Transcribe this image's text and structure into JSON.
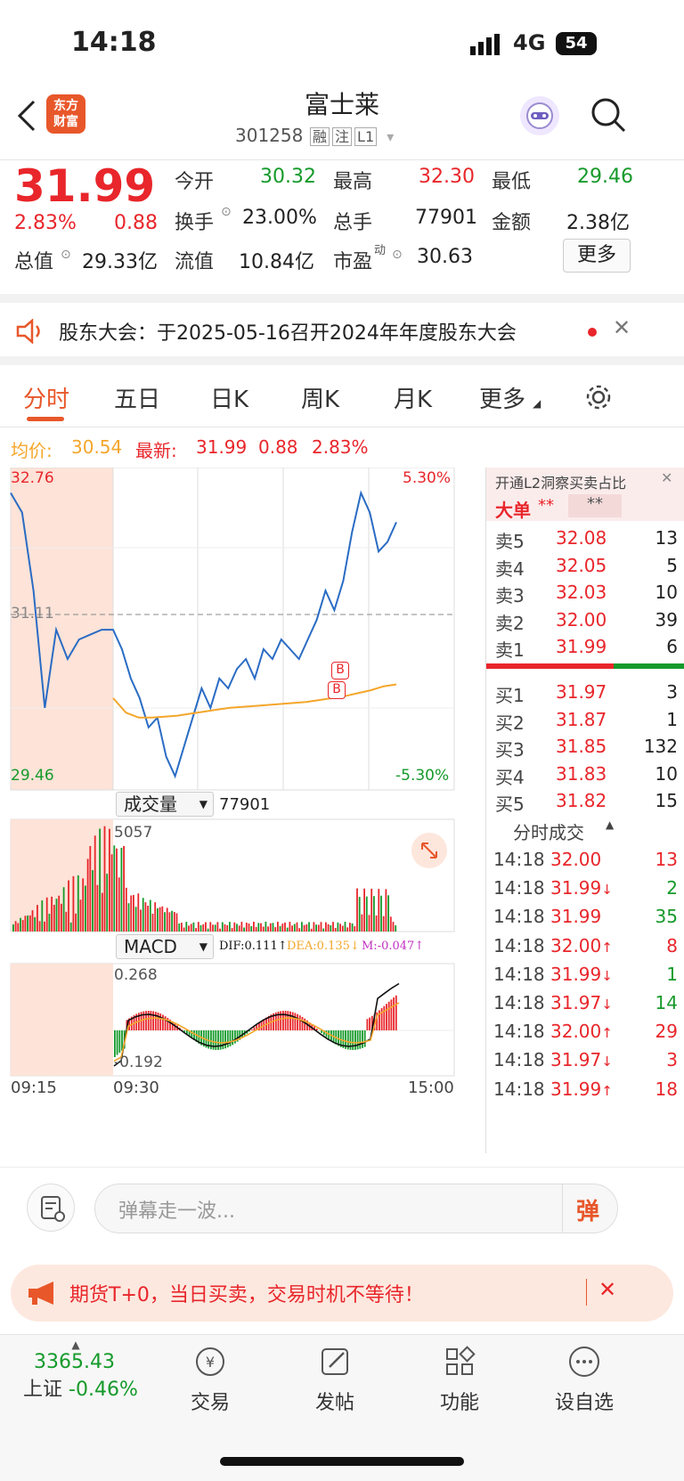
{
  "status": {
    "time": "14:18",
    "network": "4G",
    "battery": "54"
  },
  "header": {
    "logo_line1": "东方",
    "logo_line2": "财富",
    "name": "富士莱",
    "code": "301258",
    "tags": [
      "融",
      "注",
      "L1"
    ]
  },
  "quote": {
    "price": "31.99",
    "change_pct": "2.83%",
    "change": "0.88",
    "stats": [
      {
        "label": "今开",
        "value": "30.32",
        "color": "green"
      },
      {
        "label": "最高",
        "value": "32.30",
        "color": "red"
      },
      {
        "label": "最低",
        "value": "29.46",
        "color": "green"
      },
      {
        "label": "换手",
        "value": "23.00%",
        "color": "dark"
      },
      {
        "label": "总手",
        "value": "77901",
        "color": "dark"
      },
      {
        "label": "金额",
        "value": "2.38亿",
        "color": "dark"
      },
      {
        "label": "总值",
        "value": "29.33亿",
        "color": "dark"
      },
      {
        "label": "流值",
        "value": "10.84亿",
        "color": "dark"
      },
      {
        "label": "市盈",
        "value": "30.63",
        "color": "dark"
      }
    ],
    "pe_superscript": "动",
    "more": "更多"
  },
  "notice": {
    "text": "股东大会：于2025-05-16召开2024年年度股东大会"
  },
  "tabs": [
    "分时",
    "五日",
    "日K",
    "周K",
    "月K",
    "更多"
  ],
  "chart_info": {
    "avg_label": "均价:",
    "avg": "30.54",
    "last_label": "最新:",
    "last": "31.99",
    "chg": "0.88",
    "pct": "2.83%"
  },
  "chart_data": {
    "type": "line",
    "y_top": "32.76",
    "y_bottom": "29.46",
    "y_mid": "31.11",
    "pct_top": "5.30%",
    "pct_bottom": "-5.30%",
    "ylim": [
      29.46,
      32.76
    ],
    "x_start": "09:15",
    "x_mid": "09:30",
    "x_end": "15:00",
    "series": [
      {
        "values": [
          32.5,
          32.3,
          31.5,
          30.3,
          31.1,
          30.8,
          31.0,
          31.05,
          31.1,
          31.1,
          31.1,
          30.9,
          30.6,
          30.4,
          30.1,
          30.2,
          29.8,
          29.6,
          29.9,
          30.2,
          30.5,
          30.3,
          30.6,
          30.5,
          30.7,
          30.8,
          30.6,
          30.9,
          30.8,
          31.0,
          30.9,
          30.8,
          31.0,
          31.2,
          31.5,
          31.3,
          31.6,
          32.1,
          32.5,
          32.3,
          31.9,
          32.0,
          32.2
        ]
      },
      {
        "values": [
          30.4,
          30.25,
          30.2,
          30.2,
          30.21,
          30.22,
          30.24,
          30.26,
          30.28,
          30.3,
          30.31,
          30.32,
          30.33,
          30.34,
          30.35,
          30.36,
          30.38,
          30.4,
          30.42,
          30.45,
          30.48,
          30.52,
          30.54
        ]
      }
    ],
    "volume_label": "成交量",
    "volume_total": "77901",
    "volume_max": "5057",
    "macd_label": "MACD",
    "dif": "DIF:0.111",
    "dea": "DEA:0.135",
    "m": "M:-0.047",
    "macd_top": "0.268",
    "macd_bottom": "-0.192"
  },
  "orderbook": {
    "promo": "开通L2洞察买卖占比",
    "big_order": "大单",
    "stars": "**",
    "asks": [
      {
        "label": "卖5",
        "price": "32.08",
        "vol": "13"
      },
      {
        "label": "卖4",
        "price": "32.05",
        "vol": "5"
      },
      {
        "label": "卖3",
        "price": "32.03",
        "vol": "10"
      },
      {
        "label": "卖2",
        "price": "32.00",
        "vol": "39"
      },
      {
        "label": "卖1",
        "price": "31.99",
        "vol": "6"
      }
    ],
    "bids": [
      {
        "label": "买1",
        "price": "31.97",
        "vol": "3"
      },
      {
        "label": "买2",
        "price": "31.87",
        "vol": "1"
      },
      {
        "label": "买3",
        "price": "31.85",
        "vol": "132"
      },
      {
        "label": "买4",
        "price": "31.83",
        "vol": "10"
      },
      {
        "label": "买5",
        "price": "31.82",
        "vol": "15"
      }
    ],
    "ticks_title": "分时成交",
    "ticks": [
      {
        "time": "14:18",
        "price": "32.00",
        "arrow": "",
        "vol": "13",
        "pc": "red",
        "vc": "red"
      },
      {
        "time": "14:18",
        "price": "31.99",
        "arrow": "↓",
        "vol": "2",
        "pc": "red",
        "vc": "green"
      },
      {
        "time": "14:18",
        "price": "31.99",
        "arrow": "",
        "vol": "35",
        "pc": "red",
        "vc": "green"
      },
      {
        "time": "14:18",
        "price": "32.00",
        "arrow": "↑",
        "vol": "8",
        "pc": "red",
        "vc": "red"
      },
      {
        "time": "14:18",
        "price": "31.99",
        "arrow": "↓",
        "vol": "1",
        "pc": "red",
        "vc": "green"
      },
      {
        "time": "14:18",
        "price": "31.97",
        "arrow": "↓",
        "vol": "14",
        "pc": "red",
        "vc": "green"
      },
      {
        "time": "14:18",
        "price": "32.00",
        "arrow": "↑",
        "vol": "29",
        "pc": "red",
        "vc": "red"
      },
      {
        "time": "14:18",
        "price": "31.97",
        "arrow": "↓",
        "vol": "3",
        "pc": "red",
        "vc": "red"
      },
      {
        "time": "14:18",
        "price": "31.99",
        "arrow": "↑",
        "vol": "18",
        "pc": "red",
        "vc": "red"
      }
    ]
  },
  "danmu": {
    "placeholder": "弹幕走一波...",
    "btn": "弹"
  },
  "ad": {
    "text": "期货T+0，当日买卖，交易时机不等待！"
  },
  "tabbar": {
    "index_value": "3365.43",
    "index_name": "上证",
    "index_pct": "-0.46%",
    "items": [
      "交易",
      "发帖",
      "功能",
      "设自选"
    ]
  },
  "colors": {
    "red": "#e8262b",
    "green": "#169a2b",
    "orange": "#f4a62a",
    "blue": "#2a6cc4",
    "accent": "#e8572a"
  }
}
